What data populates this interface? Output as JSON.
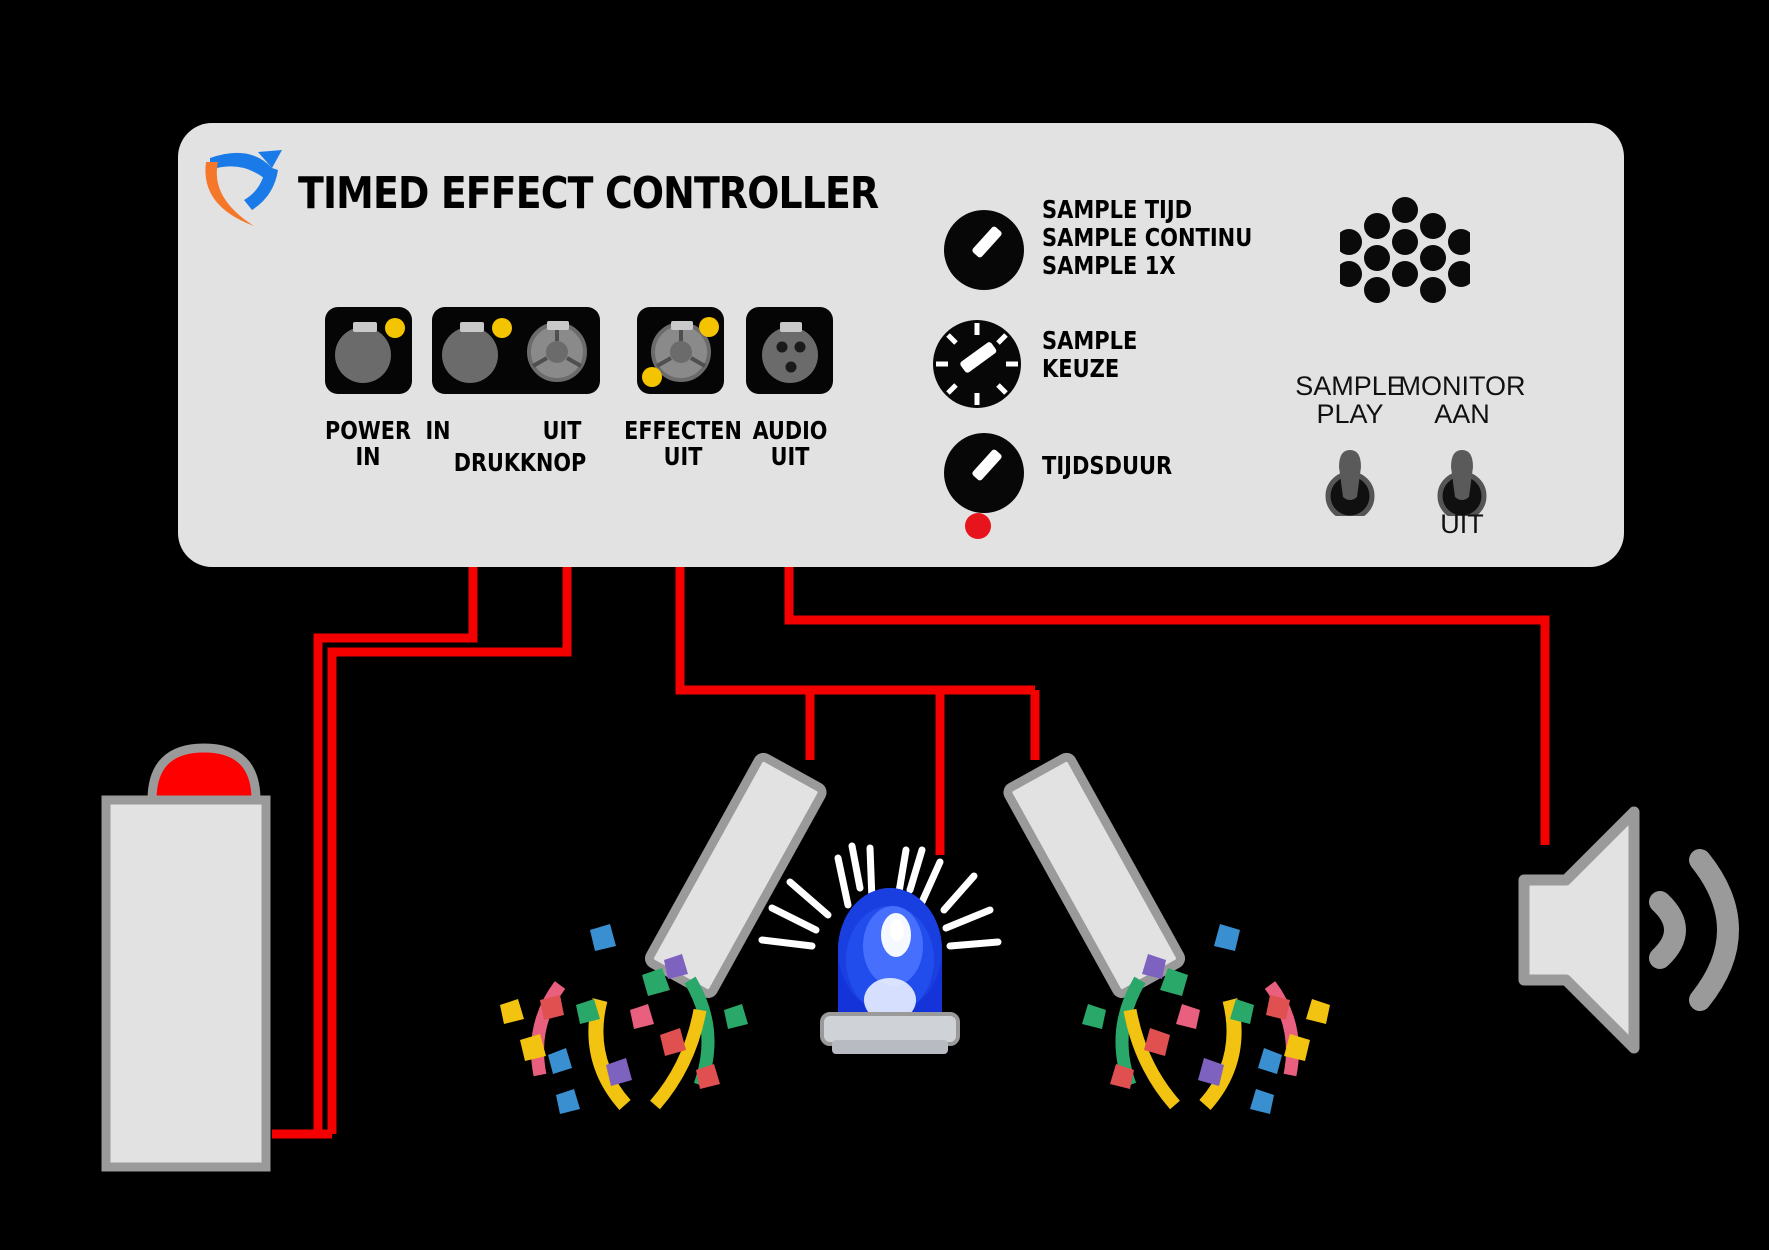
{
  "panel": {
    "title": "TIMED EFFECT CONTROLLER",
    "logo_icon": "blue-orange-swoosh-arrow-logo",
    "background_color": "#e2e2e2",
    "connectors": [
      {
        "name": "power-in",
        "label_line1": "POWER",
        "label_line2": "IN",
        "type": "powercon",
        "latch_color": "#f5c400"
      },
      {
        "name": "drukknop-in",
        "label_line1": "IN",
        "label_line2": "DRUKKNOP",
        "type": "powercon",
        "latch_color": "#f5c400"
      },
      {
        "name": "drukknop-uit",
        "label_line1": "UIT",
        "label_line2": "",
        "type": "speakon",
        "latch_color": "#f5c400"
      },
      {
        "name": "effecten-uit",
        "label_line1": "EFFECTEN",
        "label_line2": "UIT",
        "type": "speakon",
        "latch_color": "#f5c400"
      },
      {
        "name": "audio-uit",
        "label_line1": "AUDIO",
        "label_line2": "UIT",
        "type": "xlr",
        "latch_color": "#f5c400"
      }
    ],
    "knobs": [
      {
        "name": "sample-mode-knob",
        "labels": [
          "SAMPLE TIJD",
          "SAMPLE CONTINU",
          "SAMPLE 1X"
        ],
        "ticks": false,
        "pointer_angle_deg": 45
      },
      {
        "name": "sample-keuze-knob",
        "labels": [
          "SAMPLE",
          "KEUZE"
        ],
        "ticks": true,
        "pointer_angle_deg": 55
      },
      {
        "name": "tijdsduur-knob",
        "labels": [
          "TIJDSDUUR"
        ],
        "ticks": false,
        "pointer_angle_deg": 45
      }
    ],
    "led": {
      "name": "status-led",
      "color": "#e8141b"
    },
    "speaker_grille": {
      "name": "speaker-grille",
      "hole_count": 13
    },
    "switches": [
      {
        "name": "sample-play-switch",
        "label_top1": "SAMPLE",
        "label_top2": "PLAY",
        "label_bottom": "",
        "position": "up"
      },
      {
        "name": "monitor-switch",
        "label_top1": "MONITOR",
        "label_top2": "AAN",
        "label_bottom": "UIT",
        "position": "up"
      }
    ]
  },
  "devices": [
    {
      "name": "pushbutton-device",
      "description": "grey box with red dome pushbutton",
      "button_color": "#ff0000",
      "body_color": "#e2e2e2"
    },
    {
      "name": "confetti-cannon-left",
      "description": "confetti cannon tube firing confetti"
    },
    {
      "name": "beacon-light",
      "description": "blue rotating beacon light",
      "dome_color": "#1433d8"
    },
    {
      "name": "confetti-cannon-right",
      "description": "confetti cannon tube firing confetti"
    },
    {
      "name": "speaker-device",
      "description": "loudspeaker with sound waves",
      "color": "#c9c9c9"
    }
  ],
  "wiring": {
    "cable_color": "#f50000",
    "description": "red cables connecting panel connectors to devices"
  }
}
